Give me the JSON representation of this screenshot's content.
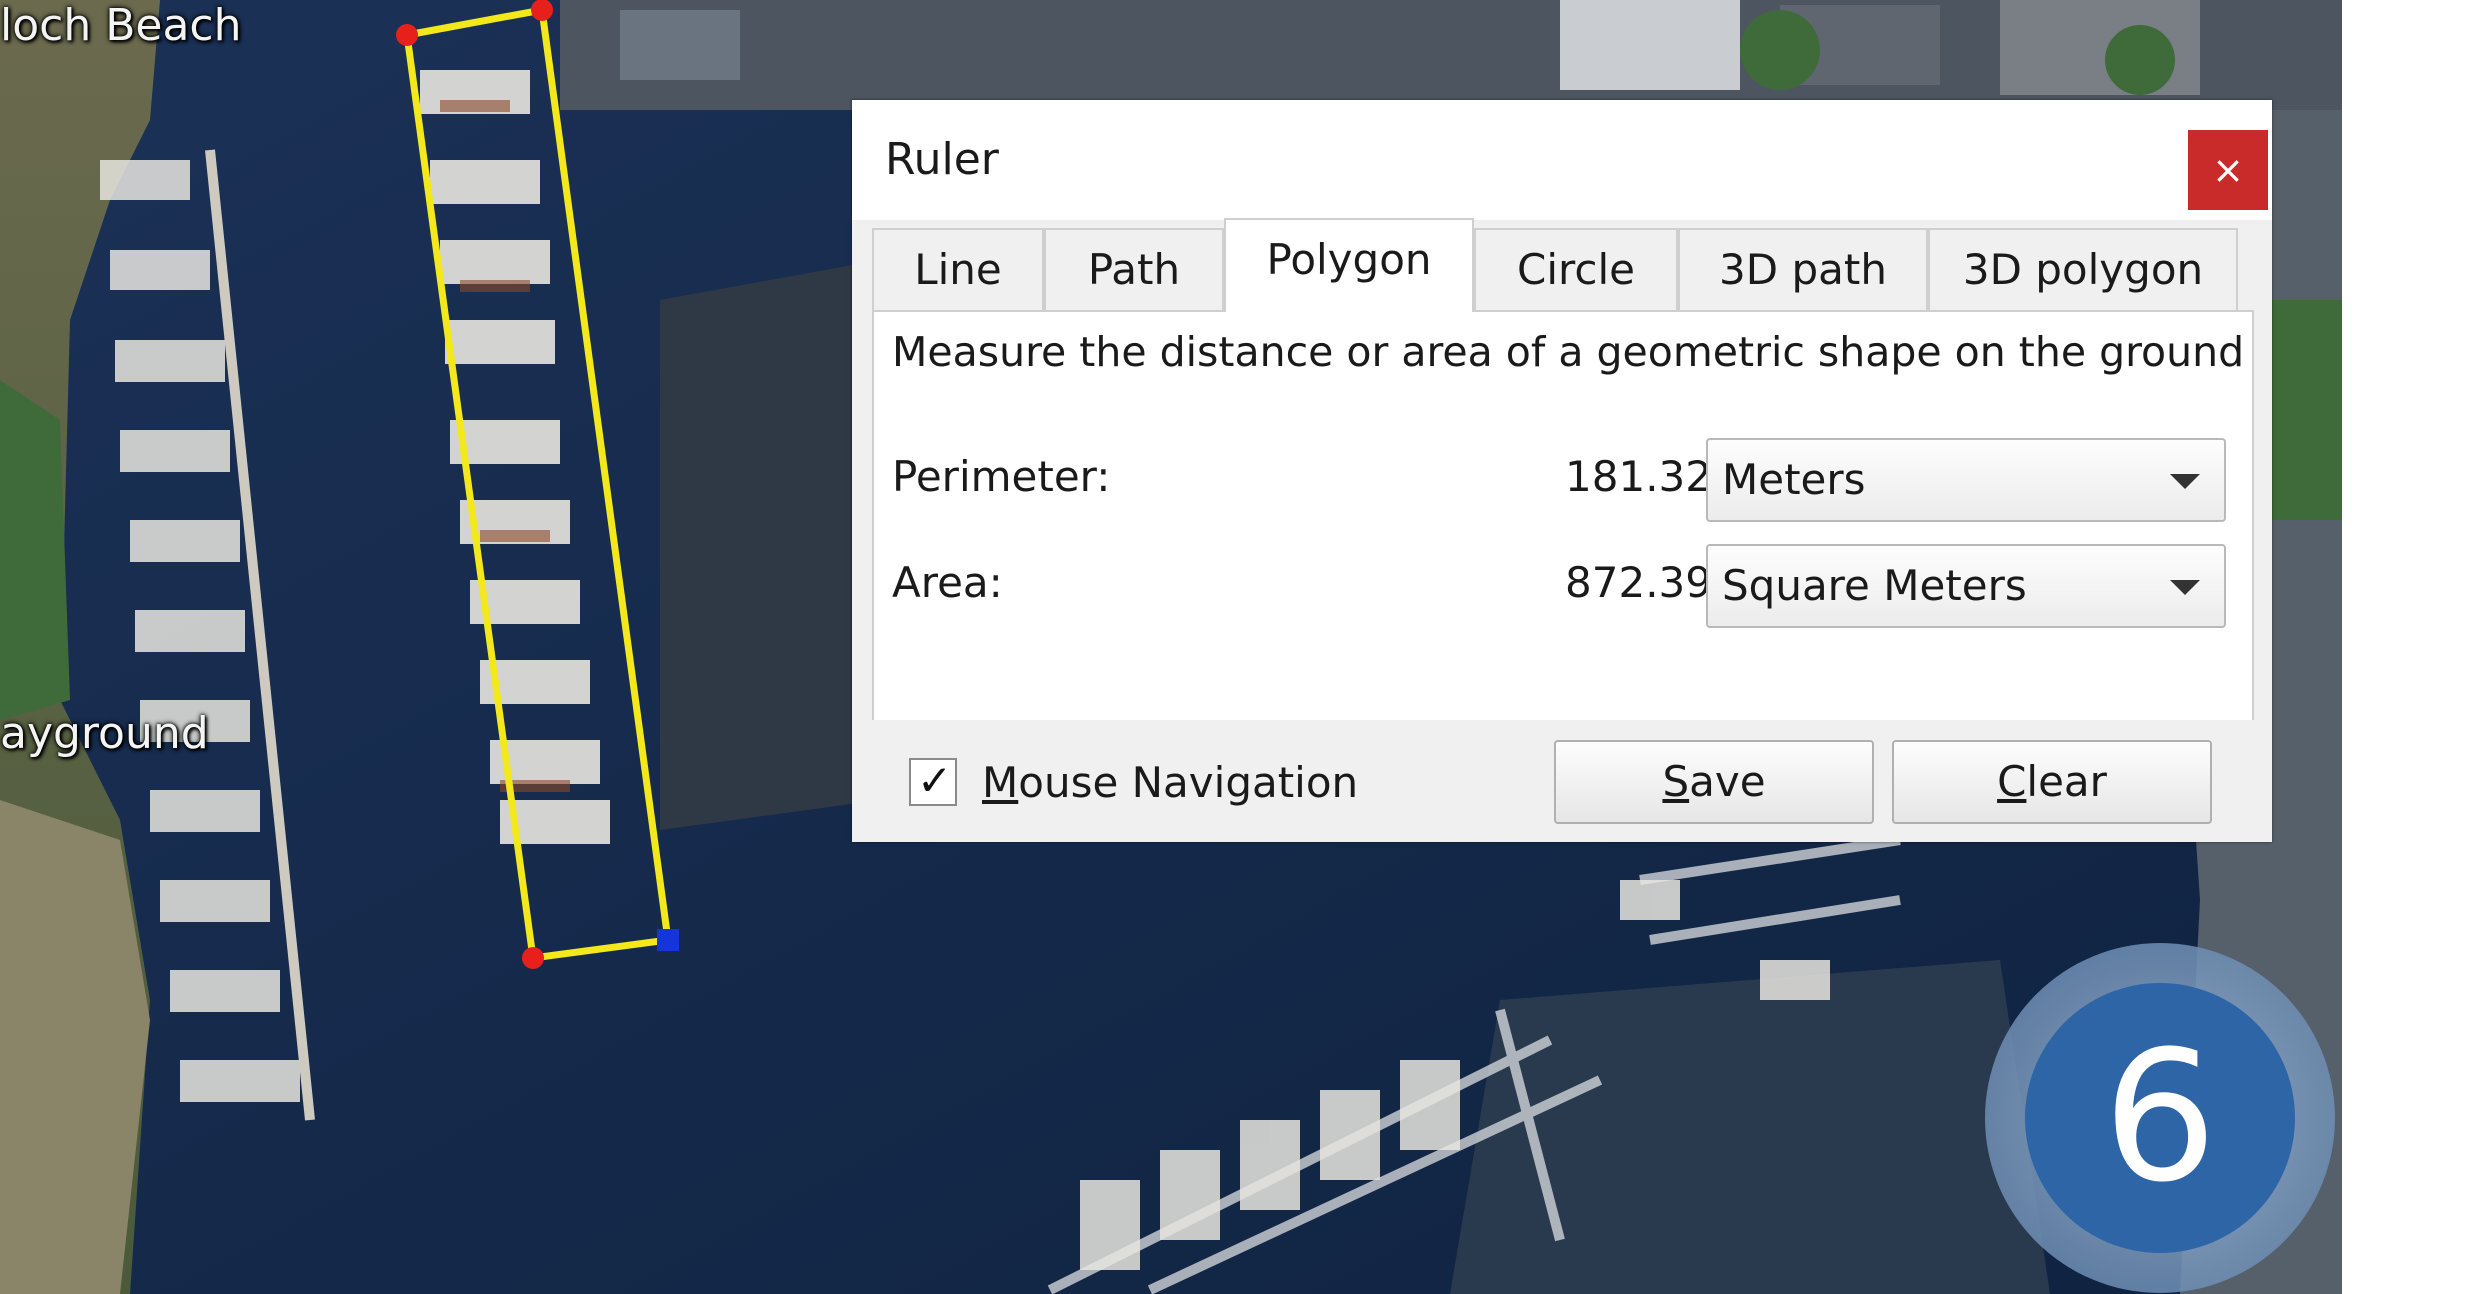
{
  "map": {
    "labels": [
      "loch Beach",
      "ayground"
    ],
    "measure_line_color": "#f2e81c",
    "vertex_colors": [
      "#e8201c",
      "#1436d8"
    ]
  },
  "dialog": {
    "title": "Ruler",
    "close_label": "×",
    "tabs": [
      "Line",
      "Path",
      "Polygon",
      "Circle",
      "3D path",
      "3D polygon"
    ],
    "active_tab": "Polygon",
    "description": "Measure the distance or area of a geometric shape on the ground",
    "perimeter": {
      "label": "Perimeter:",
      "value": "181.32",
      "unit": "Meters"
    },
    "area": {
      "label": "Area:",
      "value": "872.39",
      "unit": "Square Meters"
    },
    "mouse_navigation": {
      "label": "Mouse Navigation",
      "checked": true,
      "mark": "✓"
    },
    "save_label": "Save",
    "clear_label": "Clear"
  },
  "badge": {
    "number": "6",
    "color": "#2d65a7"
  }
}
